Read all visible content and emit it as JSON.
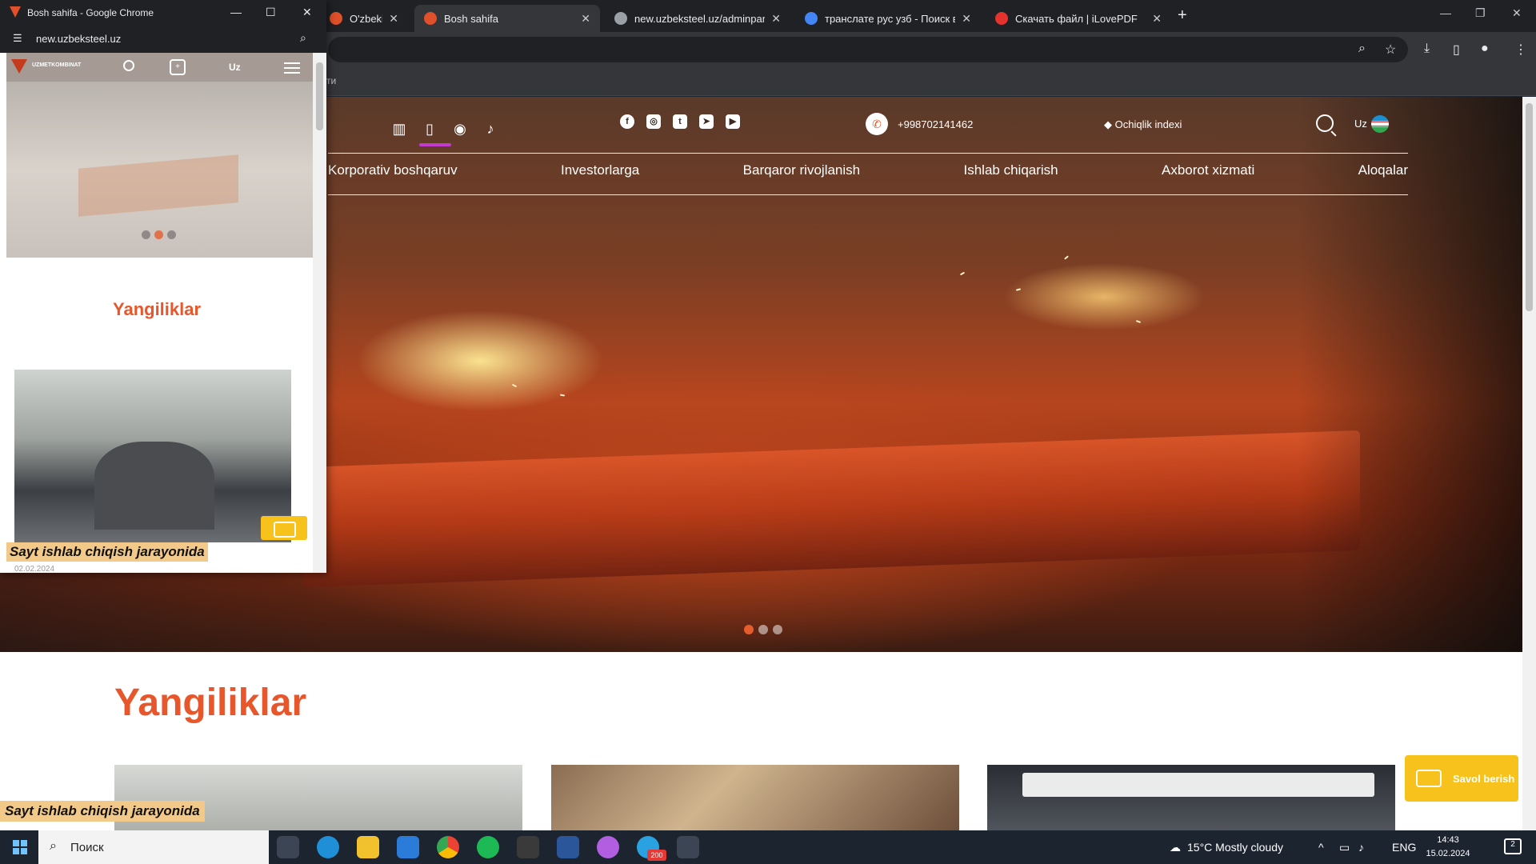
{
  "browser": {
    "tabs": [
      {
        "title": "O'zbekiston",
        "color": "#e0502a"
      },
      {
        "title": "Bosh sahifa",
        "color": "#e0502a"
      },
      {
        "title": "new.uzbeksteel.uz/adminpanel/",
        "color": "#9aa0a6"
      },
      {
        "title": "транслате рус узб - Поиск в Go",
        "color": "#4285f4"
      },
      {
        "title": "Скачать файл | iLovePDF",
        "color": "#e5322d"
      }
    ],
    "close_glyph": "✕",
    "newtab_glyph": "+",
    "bookmark_text": "ти"
  },
  "popup": {
    "window_title": "Bosh sahifa - Google Chrome",
    "url": "new.uzbeksteel.uz",
    "logo_text": "UZMETKOMBINAT",
    "lang": "Uz",
    "news_heading": "Yangiliklar",
    "banner": "Sayt ishlab chiqish jarayonida",
    "date": "02.02.2024"
  },
  "site": {
    "phone": "+998702141462",
    "openness": "◆ Ochiqlik indexi",
    "lang": "Uz",
    "nav": [
      "Korporativ boshqaruv",
      "Investorlarga",
      "Barqaror rivojlanish",
      "Ishlab chiqarish",
      "Axborot xizmati",
      "Aloqalar"
    ],
    "news_heading": "Yangiliklar",
    "banner": "Sayt ishlab chiqish jarayonida",
    "ask_button": "Savol berish",
    "accent": "#e8562b"
  },
  "taskbar": {
    "search_placeholder": "Поиск",
    "weather": "15°C  Mostly cloudy",
    "lang": "ENG",
    "time": "14:43",
    "date": "15.02.2024",
    "notifications": "2",
    "telegram_badge": "200"
  }
}
